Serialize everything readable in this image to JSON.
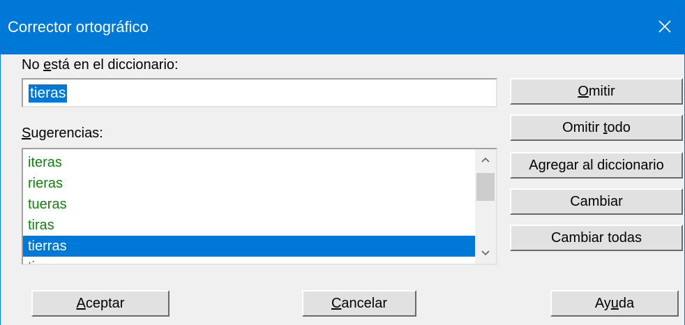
{
  "window": {
    "title": "Corrector ortográfico",
    "close_glyph": "✕"
  },
  "not_in_dictionary": {
    "label_pre": "No ",
    "label_key": "e",
    "label_post": "stá en el diccionario:",
    "value": "tieras"
  },
  "suggestions": {
    "label_pre": "",
    "label_key": "S",
    "label_post": "ugerencias:",
    "items": [
      "iteras",
      "rieras",
      "tueras",
      "tiras",
      "tierras",
      "tiernas"
    ],
    "selected_index": 4
  },
  "side_buttons": {
    "omitir": {
      "pre": "",
      "key": "O",
      "post": "mitir"
    },
    "omitir_todo": {
      "pre": "Omitir ",
      "key": "t",
      "post": "odo"
    },
    "agregar": {
      "pre": "A",
      "key": "g",
      "post": "regar al diccionario"
    },
    "cambiar": {
      "pre": "Cambiar",
      "key": "",
      "post": ""
    },
    "cambiar_todas": {
      "pre": "Cambiar todas",
      "key": "",
      "post": ""
    }
  },
  "bottom_buttons": {
    "aceptar": {
      "pre": "",
      "key": "A",
      "post": "ceptar"
    },
    "cancelar": {
      "pre": "",
      "key": "C",
      "post": "ancelar"
    },
    "ayuda": {
      "pre": "Ay",
      "key": "u",
      "post": "da"
    }
  },
  "colors": {
    "titlebar": "#0078d7",
    "suggestion_text": "#108010",
    "selection": "#0078d7"
  }
}
